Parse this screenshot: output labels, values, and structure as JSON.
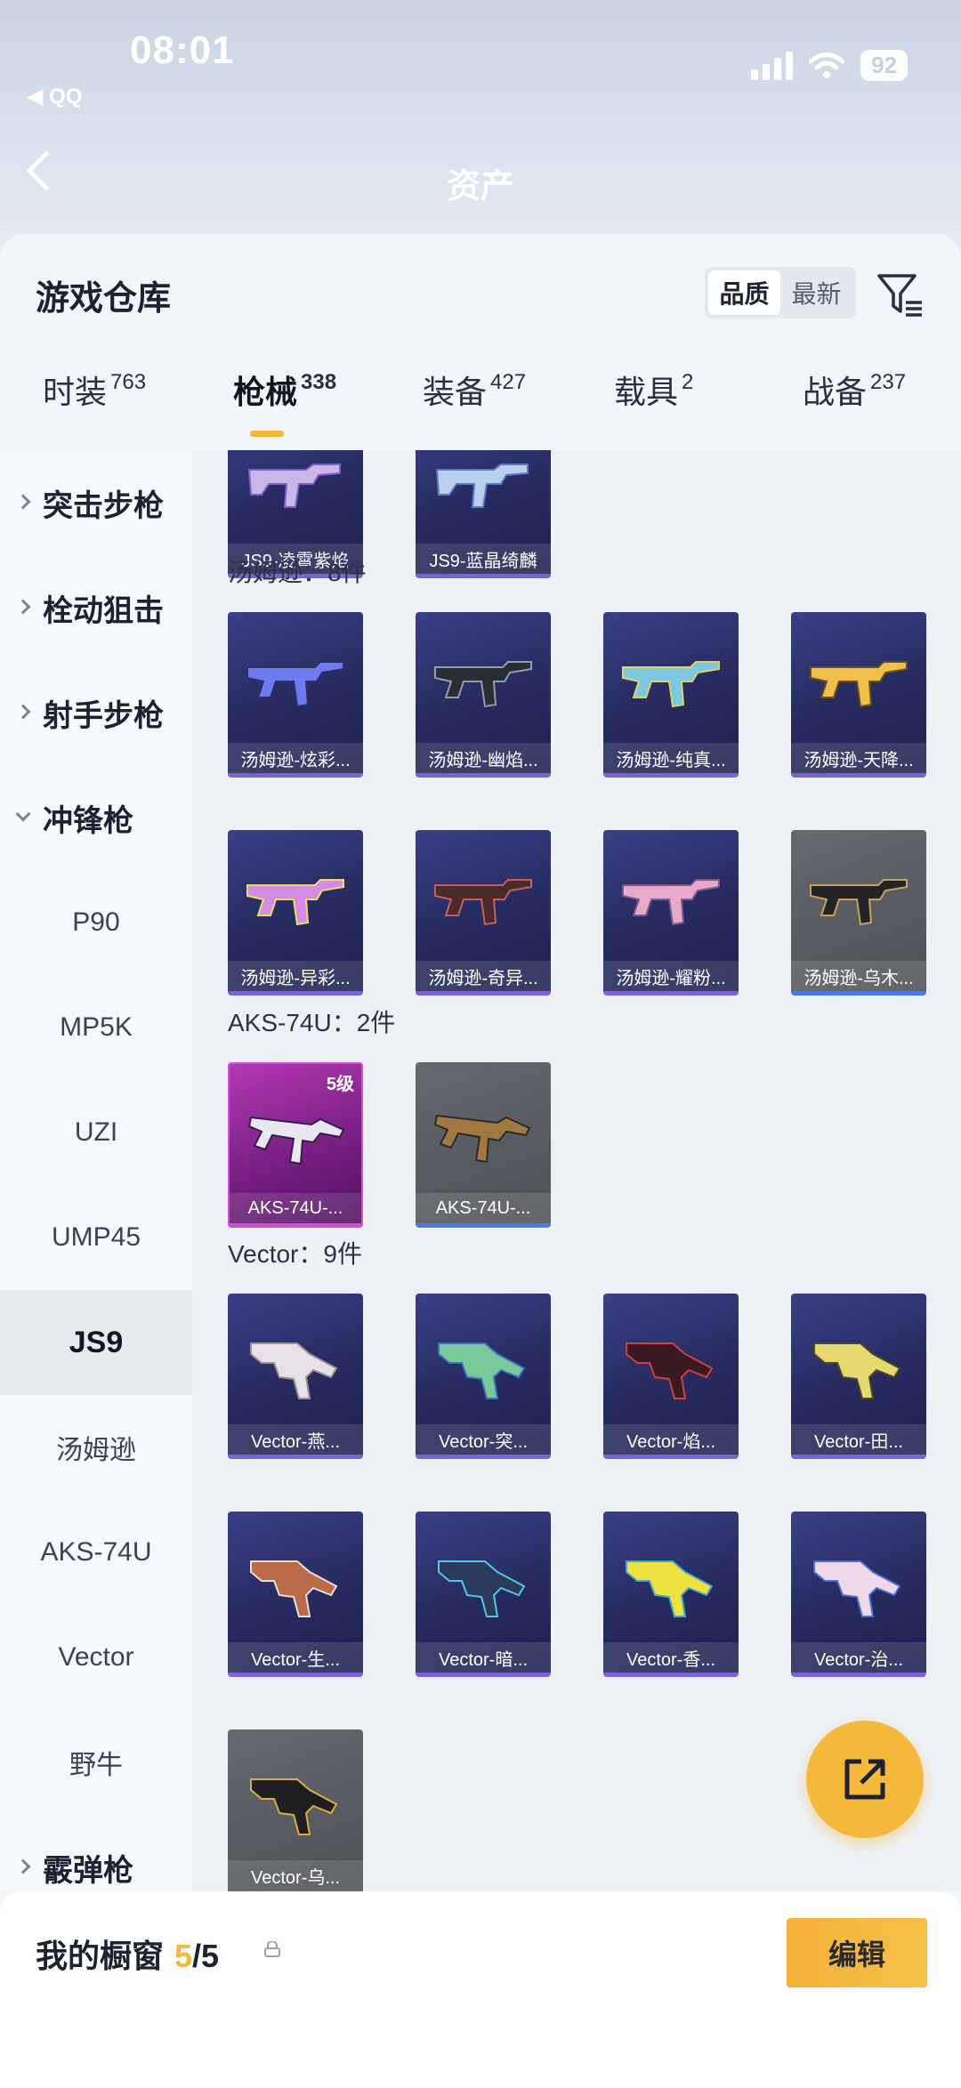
{
  "status_bar": {
    "time": "08:01",
    "back_app": "◀ QQ",
    "battery": "92"
  },
  "background": {
    "asset_label": "资产"
  },
  "sheet": {
    "title": "游戏仓库",
    "sort_options": [
      "品质",
      "最新"
    ],
    "active_sort": "品质"
  },
  "tabs": [
    {
      "label": "时装",
      "count": "763"
    },
    {
      "label": "枪械",
      "count": "338"
    },
    {
      "label": "装备",
      "count": "427"
    },
    {
      "label": "载具",
      "count": "2"
    },
    {
      "label": "战备",
      "count": "237"
    }
  ],
  "sidebar": {
    "items": [
      {
        "label": "突击步枪"
      },
      {
        "label": "栓动狙击"
      },
      {
        "label": "射手步枪"
      },
      {
        "label": "冲锋枪"
      },
      {
        "label": "P90"
      },
      {
        "label": "MP5K"
      },
      {
        "label": "UZI"
      },
      {
        "label": "UMP45"
      },
      {
        "label": "JS9"
      },
      {
        "label": "汤姆逊"
      },
      {
        "label": "AKS-74U"
      },
      {
        "label": "Vector"
      },
      {
        "label": "野牛"
      },
      {
        "label": "霰弹枪"
      }
    ]
  },
  "content": {
    "js9_items": [
      "JS9-凌霄紫焰",
      "JS9-蓝晶绮麟"
    ],
    "thompson_header": "汤姆逊：8件",
    "thompson_items": [
      "汤姆逊-炫彩...",
      "汤姆逊-幽焰...",
      "汤姆逊-纯真...",
      "汤姆逊-天降...",
      "汤姆逊-异彩...",
      "汤姆逊-奇异...",
      "汤姆逊-耀粉...",
      "汤姆逊-乌木..."
    ],
    "aks_header": "AKS-74U：2件",
    "aks_items": [
      "AKS-74U-...",
      "AKS-74U-..."
    ],
    "aks_level": "5级",
    "vector_header": "Vector：9件",
    "vector_items": [
      "Vector-燕...",
      "Vector-突...",
      "Vector-焰...",
      "Vector-田...",
      "Vector-生...",
      "Vector-暗...",
      "Vector-香...",
      "Vector-治...",
      "Vector-乌..."
    ]
  },
  "bottom": {
    "showcase_label": "我的橱窗",
    "showcase_count": "5",
    "showcase_total": "/5",
    "edit_label": "编辑"
  },
  "colors": {
    "accent": "#f4b83b",
    "card_purple": "#2b2f6a",
    "card_gray": "#5a5d63",
    "card_pink": "#a02fa6"
  }
}
